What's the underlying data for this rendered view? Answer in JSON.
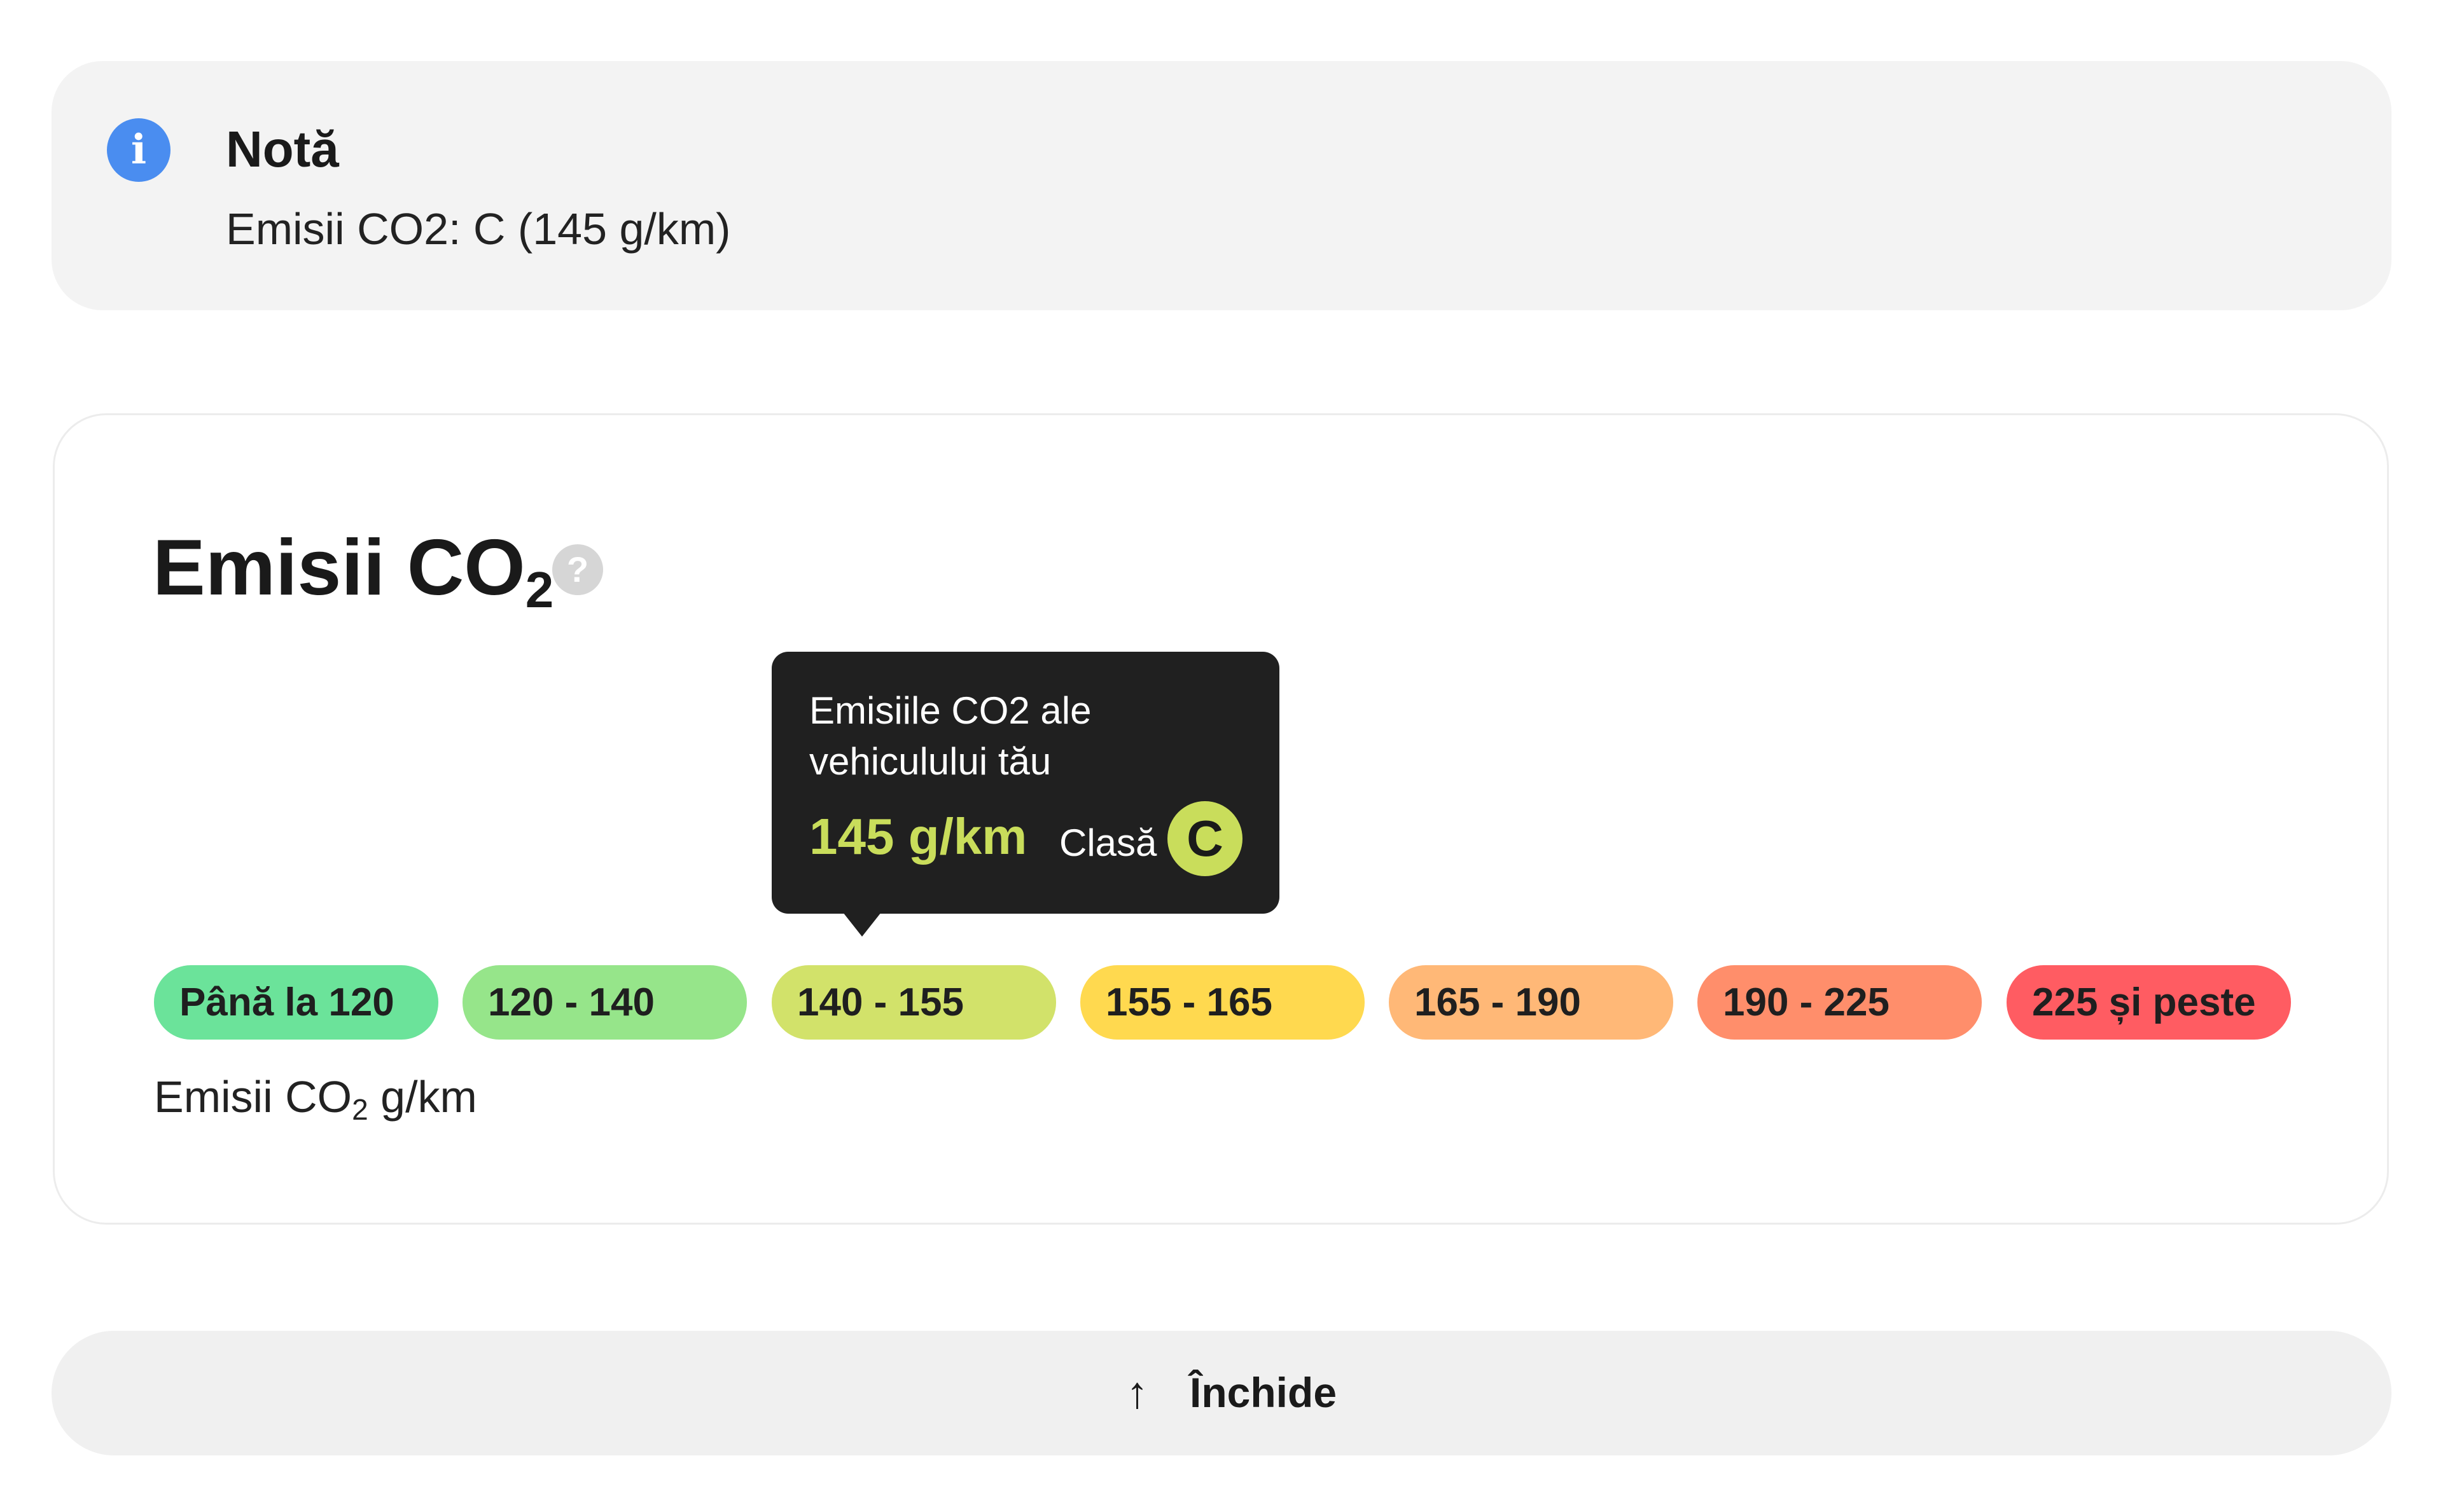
{
  "note": {
    "icon": "info-icon",
    "title": "Notă",
    "text": "Emisii CO2: C (145 g/km)"
  },
  "co2": {
    "title_main": "Emisii CO",
    "title_sub": "2",
    "help_icon": "question-icon",
    "help_glyph": "?",
    "tooltip": {
      "heading": "Emisiile CO2 ale vehiculului tău",
      "value": "145 g/km",
      "class_label": "Clasă",
      "class_value": "C"
    },
    "scale": [
      {
        "label": "Până la 120",
        "color": "#6be39a"
      },
      {
        "label": "120 - 140",
        "color": "#96e58a"
      },
      {
        "label": "140 - 155",
        "color": "#d2e26a"
      },
      {
        "label": "155 - 165",
        "color": "#ffd94f"
      },
      {
        "label": "165 - 190",
        "color": "#ffb877"
      },
      {
        "label": "190 - 225",
        "color": "#ff8e6b"
      },
      {
        "label": "225 și peste",
        "color": "#ff5c62"
      }
    ],
    "caption_main": "Emisii CO",
    "caption_sub": "2",
    "caption_unit": " g/km"
  },
  "close_button": {
    "icon": "arrow-up-icon",
    "arrow_glyph": "↑",
    "label": "Închide"
  }
}
